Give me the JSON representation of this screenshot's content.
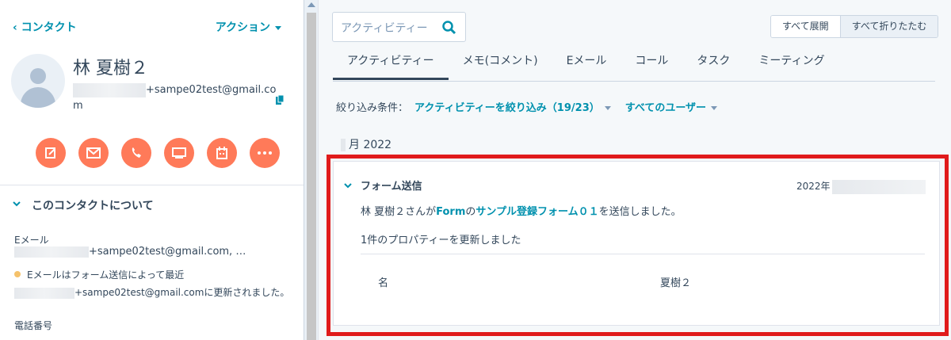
{
  "left": {
    "back_label": "‹ コンタクト",
    "actions_label": "アクション",
    "contact_name": "林 夏樹２",
    "email_display": "+sampe02test@gmail.com",
    "action_icons": [
      "note-icon",
      "email-icon",
      "call-icon",
      "log-icon",
      "meeting-icon",
      "more-icon"
    ],
    "about_title": "このコンタクトについて",
    "email_label": "Eメール",
    "email_value": "+sampe02test@gmail.com, …",
    "note_text": "Eメールはフォーム送信によって最近",
    "note_text2": "+sampe02test@gmail.comに更新されました。",
    "phone_label": "電話番号"
  },
  "right": {
    "search_placeholder": "アクティビティー",
    "expand_all": "すべて展開",
    "collapse_all": "すべて折りたたむ",
    "tabs": [
      {
        "label": "アクティビティー",
        "active": true
      },
      {
        "label": "メモ(コメント)",
        "active": false
      },
      {
        "label": "Eメール",
        "active": false
      },
      {
        "label": "コール",
        "active": false
      },
      {
        "label": "タスク",
        "active": false
      },
      {
        "label": "ミーティング",
        "active": false
      }
    ],
    "filter_label": "絞り込み条件：",
    "filter_activity": "アクティビティーを絞り込み（19/23）",
    "filter_users": "すべてのユーザー",
    "month": "月 2022",
    "card": {
      "title": "フォーム送信",
      "date_prefix": "2022年",
      "desc_prefix": "林 夏樹２さんが",
      "desc_form": "Form",
      "desc_mid": "の",
      "desc_form_name": "サンプル登録フォーム０１",
      "desc_suffix": "を送信しました。",
      "updated": "1件のプロパティーを更新しました",
      "prop_name": "名",
      "prop_value": "夏樹２"
    }
  },
  "colors": {
    "accent": "#0091ae",
    "action_button": "#ff7a59",
    "highlight": "#e01b1b"
  }
}
